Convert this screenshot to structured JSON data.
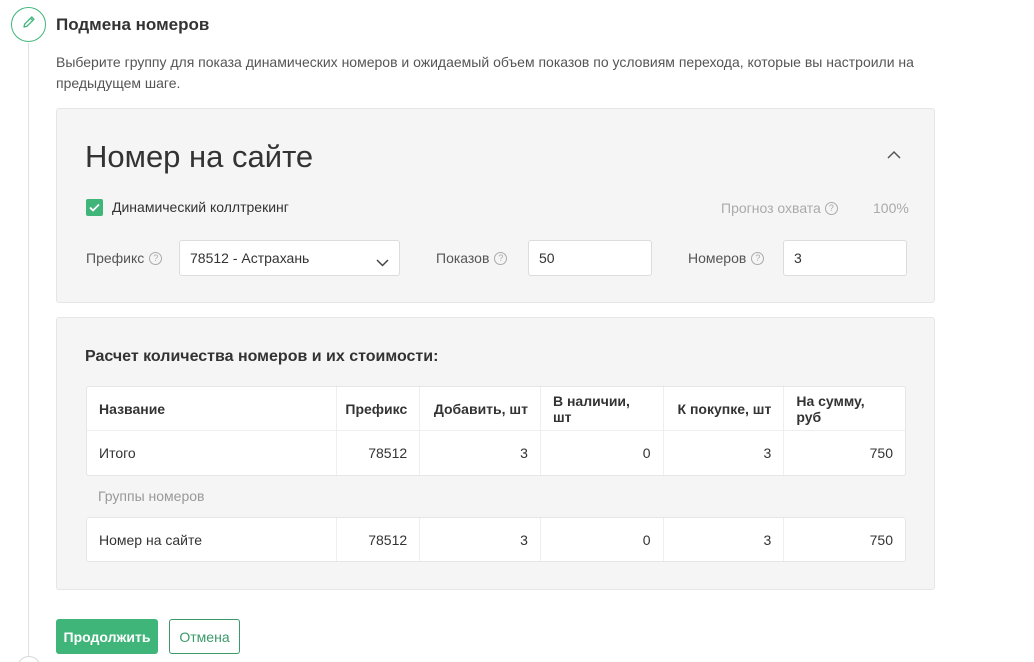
{
  "step": {
    "title": "Подмена номеров",
    "description": "Выберите группу для показа динамических номеров и ожидаемый объем показов по условиям перехода, которые вы настроили на предыдущем шаге."
  },
  "site_number": {
    "title": "Номер на сайте",
    "dynamic_label": "Динамический коллтрекинг",
    "dynamic_checked": true,
    "forecast_label": "Прогноз охвата",
    "forecast_value": "100%",
    "prefix_label": "Префикс",
    "prefix_value": "78512 - Астрахань",
    "shows_label": "Показов",
    "shows_value": "50",
    "numbers_label": "Номеров",
    "numbers_value": "3"
  },
  "calculation": {
    "title": "Расчет количества номеров и их стоимости:",
    "columns": [
      "Название",
      "Префикс",
      "Добавить, шт",
      "В наличии, шт",
      "К покупке, шт",
      "На сумму, руб"
    ],
    "total_row": [
      "Итого",
      "78512",
      "3",
      "0",
      "3",
      "750"
    ],
    "groups_label": "Группы номеров",
    "group_rows": [
      [
        "Номер на сайте",
        "78512",
        "3",
        "0",
        "3",
        "750"
      ]
    ]
  },
  "actions": {
    "continue_label": "Продолжить",
    "cancel_label": "Отмена"
  },
  "colors": {
    "accent": "#3fb57a",
    "panel_bg": "#f5f5f5"
  },
  "icons": {
    "step": "pencil-icon",
    "collapse": "chevron-up-icon",
    "select": "chevron-down-icon",
    "help": "question-circle-icon"
  }
}
